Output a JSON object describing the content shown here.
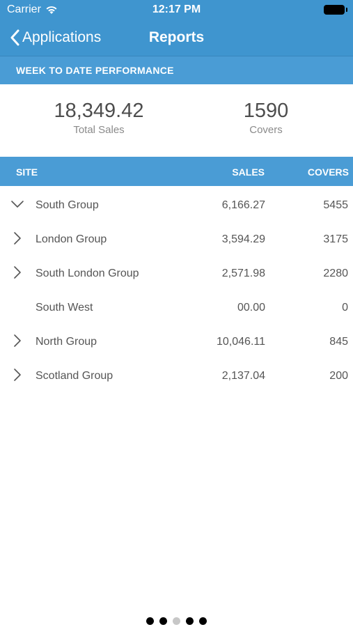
{
  "status_bar": {
    "carrier": "Carrier",
    "time": "12:17 PM"
  },
  "nav": {
    "back_label": "Applications",
    "title": "Reports"
  },
  "section_title": "WEEK TO DATE PERFORMANCE",
  "summary": {
    "total_sales_value": "18,349.42",
    "total_sales_label": "Total Sales",
    "covers_value": "1590",
    "covers_label": "Covers"
  },
  "table": {
    "headers": {
      "site": "SITE",
      "sales": "SALES",
      "covers": "COVERS"
    },
    "rows": [
      {
        "site": "South Group",
        "sales": "6,166.27",
        "covers": "5455",
        "chevron": "chevron-down"
      },
      {
        "site": "London Group",
        "sales": "3,594.29",
        "covers": "3175",
        "chevron": "chevron-right"
      },
      {
        "site": "South London Group",
        "sales": "2,571.98",
        "covers": "2280",
        "chevron": "chevron-right"
      },
      {
        "site": "South West",
        "sales": "00.00",
        "covers": "0",
        "chevron": "none"
      },
      {
        "site": "North Group",
        "sales": "10,046.11",
        "covers": "845",
        "chevron": "chevron-right"
      },
      {
        "site": "Scotland Group",
        "sales": "2,137.04",
        "covers": "200",
        "chevron": "chevron-right"
      }
    ]
  },
  "pagination": {
    "total": 5,
    "active_index": 2
  },
  "colors": {
    "header_blue": "#3f95cf",
    "banner_blue": "#4a9cd5"
  }
}
